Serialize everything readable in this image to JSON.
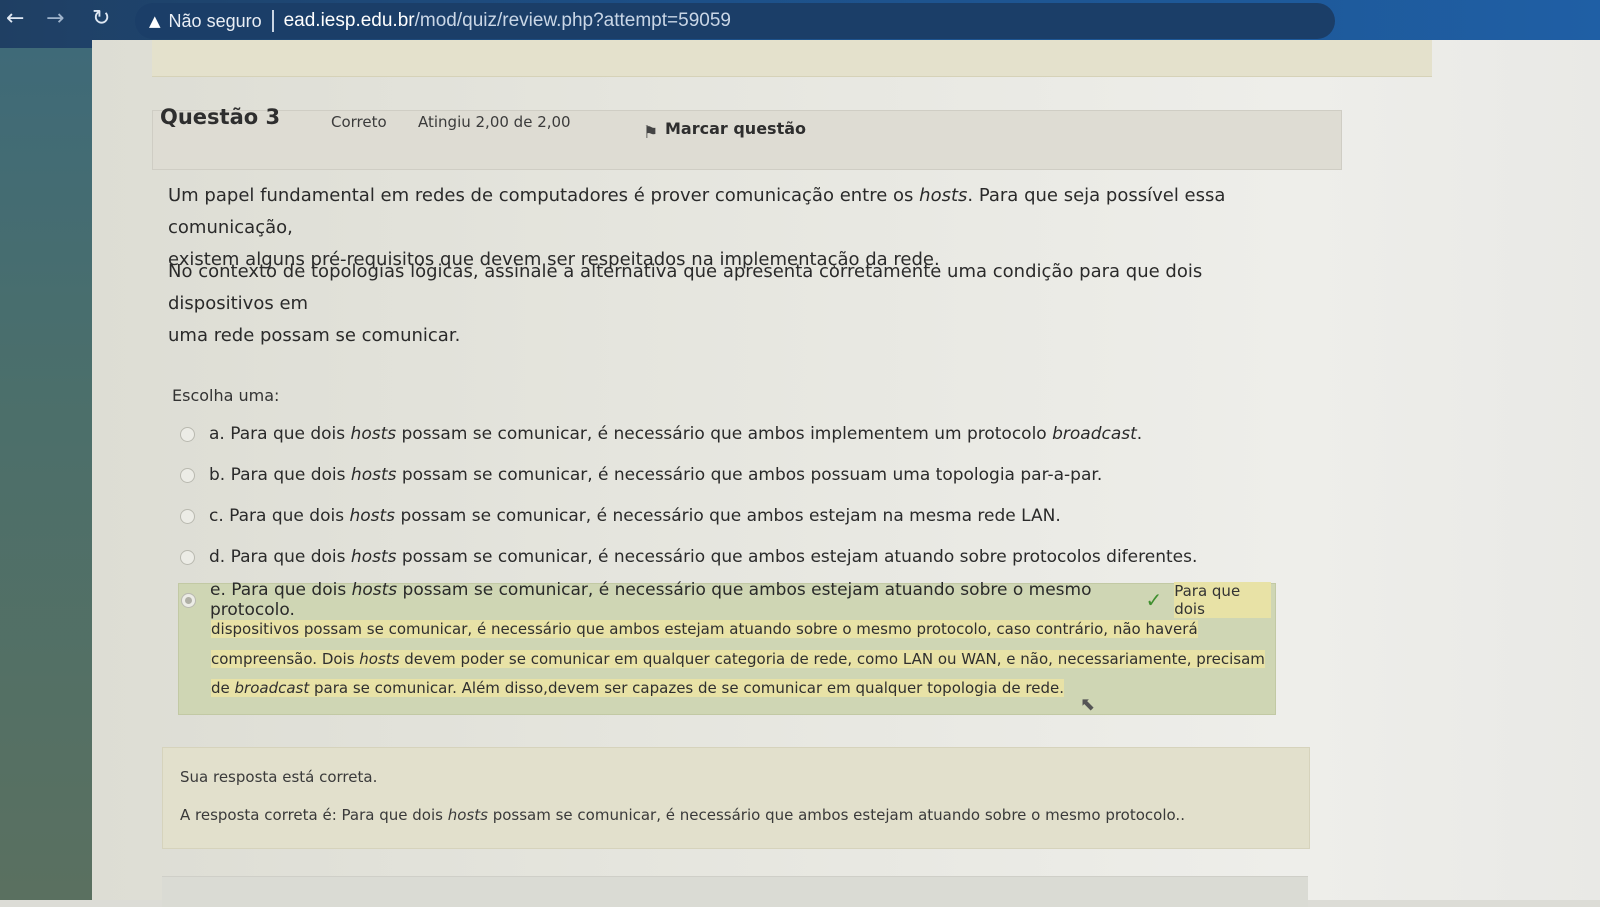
{
  "browser": {
    "security_label": "Não seguro",
    "url_host": "ead.iesp.edu.br",
    "url_path": "/mod/quiz/review.php?attempt=59059"
  },
  "question": {
    "title": "Questão 3",
    "state": "Correto",
    "grade": "Atingiu 2,00 de 2,00",
    "flag_label": "Marcar questão",
    "paragraph1": {
      "part1": "Um papel fundamental em redes de computadores é prover comunicação entre os ",
      "italic": "hosts",
      "part2": ". Para que seja possível essa comunicação,",
      "line2": "existem alguns pré-requisitos que devem ser respeitados na implementação da rede."
    },
    "paragraph2": {
      "line1": "No contexto de topologias lógicas, assinale a alternativa que apresenta corretamente uma condição para que dois dispositivos em",
      "line2": "uma rede possam se comunicar."
    },
    "prompt": "Escolha uma:"
  },
  "options": [
    {
      "prefix": "a. Para que dois ",
      "italic": "hosts",
      "suffix": " possam se comunicar, é necessário que ambos implementem um protocolo ",
      "italic2": "broadcast",
      "end": "."
    },
    {
      "prefix": "b. Para que dois ",
      "italic": "hosts",
      "suffix": " possam se comunicar, é necessário que ambos possuam uma topologia par-a-par.",
      "italic2": "",
      "end": ""
    },
    {
      "prefix": "c. Para que dois ",
      "italic": "hosts",
      "suffix": " possam se comunicar, é necessário que ambos estejam na mesma rede LAN.",
      "italic2": "",
      "end": ""
    },
    {
      "prefix": "d. Para que dois ",
      "italic": "hosts",
      "suffix": " possam se comunicar, é necessário que ambos estejam atuando sobre protocolos diferentes.",
      "italic2": "",
      "end": ""
    },
    {
      "prefix": "e. Para que dois ",
      "italic": "hosts",
      "suffix": " possam se comunicar, é necessário que ambos estejam atuando sobre o mesmo protocolo.",
      "italic2": "",
      "end": ""
    }
  ],
  "selected_option": "e",
  "specific_feedback": {
    "inline": "Para que dois",
    "line1": "dispositivos possam se comunicar, é necessário que ambos estejam atuando sobre o mesmo protocolo, caso contrário, não haverá",
    "line2_a": "compreensão. Dois ",
    "line2_italic": "hosts",
    "line2_b": " devem poder se comunicar em qualquer categoria de rede, como LAN ou WAN, e não, necessariamente, precisam",
    "line3_a": "de ",
    "line3_italic": "broadcast",
    "line3_b": " para se comunicar. Além disso,devem ser capazes de se comunicar em qualquer topologia de rede."
  },
  "general_feedback": {
    "status": "Sua resposta está correta.",
    "answer_prefix": "A resposta correta é: Para que dois ",
    "answer_italic": "hosts",
    "answer_suffix": " possam se comunicar, é necessário que ambos estejam atuando sobre o mesmo protocolo.."
  },
  "colors": {
    "correct_bg": "#cfd6b4",
    "highlight": "#e8e2a6",
    "check": "#3f8f2e"
  },
  "icons": [
    "back-arrow-icon",
    "forward-arrow-icon",
    "reload-icon",
    "warning-icon",
    "flag-icon",
    "check-icon",
    "cursor-icon"
  ]
}
